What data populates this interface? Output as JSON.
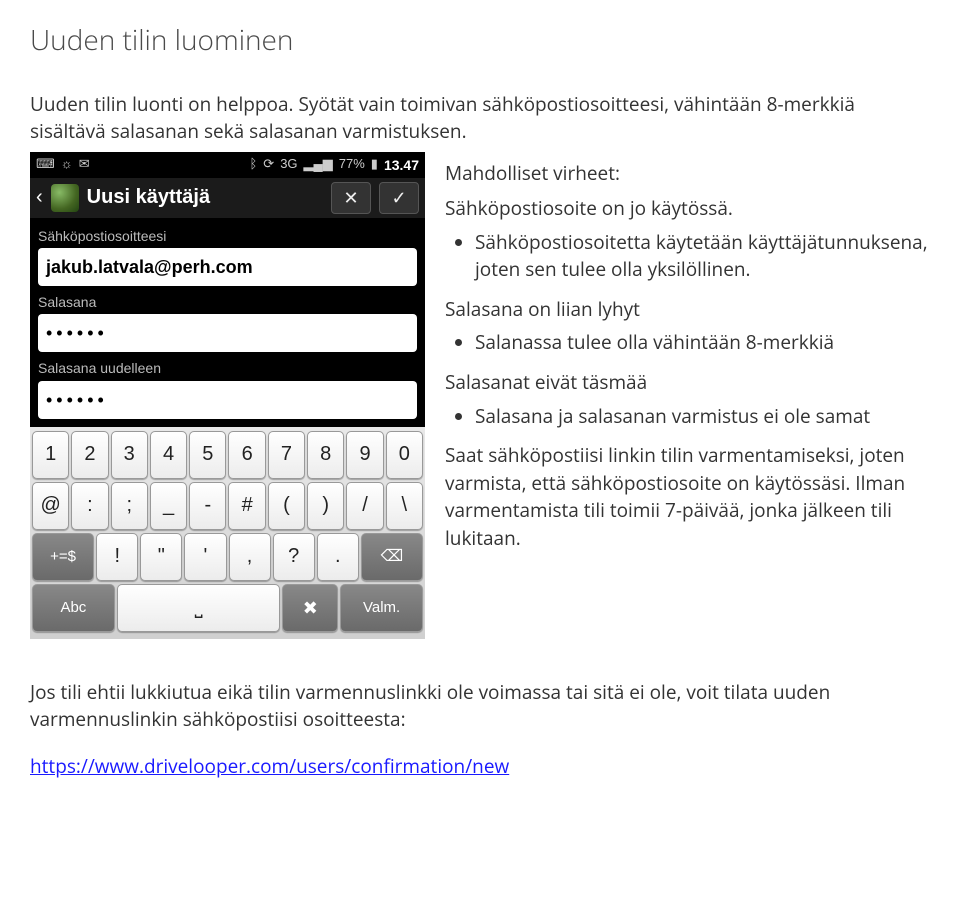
{
  "heading": "Uuden tilin luominen",
  "intro": "Uuden tilin luonti on helppoa. Syötät vain toimivan sähköpostiosoitteesi, vähintään 8-merkkiä sisältävä salasanan sekä salasanan varmistuksen.",
  "right": {
    "errors_heading": "Mahdolliset virheet:",
    "err1_title": "Sähköpostiosoite on jo käytössä.",
    "err1_item": "Sähköpostiosoitetta käytetään käyttäjätunnuksena, joten sen tulee olla yksilöllinen.",
    "err2_title": "Salasana on liian lyhyt",
    "err2_item": "Salanassa tulee olla vähintään 8-merkkiä",
    "err3_title": "Salasanat eivät täsmää",
    "err3_item": "Salasana ja salasanan varmistus ei ole samat",
    "confirm_text": "Saat sähköpostiisi linkin tilin varmentamiseksi, joten varmista, että sähköpostiosoite on käytössäsi. Ilman varmentamista tili toimii 7-päivää, jonka jälkeen tili lukitaan."
  },
  "footer": {
    "text": "Jos tili ehtii lukkiutua eikä tilin varmennuslinkki ole voimassa tai sitä ei ole, voit tilata uuden varmennuslinkin sähköpostiisi osoitteesta:",
    "link": "https://www.drivelooper.com/users/confirmation/new"
  },
  "phone": {
    "statusbar": {
      "percent": "77%",
      "time": "13.47",
      "net_label": "3G"
    },
    "title": "Uusi käyttäjä",
    "fields": {
      "email_label": "Sähköpostiosoitteesi",
      "email_value": "jakub.latvala@perh.com",
      "pwd_label": "Salasana",
      "pwd_value": "••••••",
      "pwd2_label": "Salasana uudelleen",
      "pwd2_value": "••••••"
    },
    "keyboard": {
      "row1": [
        "1",
        "2",
        "3",
        "4",
        "5",
        "6",
        "7",
        "8",
        "9",
        "0"
      ],
      "row2": [
        "@",
        ":",
        ";",
        "_",
        "-",
        "#",
        "(",
        ")",
        "/",
        "\\"
      ],
      "row3_left": "+=$",
      "row3_mid": [
        "!",
        "\"",
        "'",
        ",",
        "?",
        "."
      ],
      "row3_back": "⌫",
      "row4_abc": "Abc",
      "row4_space": "␣",
      "row4_tool": "✕",
      "row4_done": "Valm."
    }
  }
}
